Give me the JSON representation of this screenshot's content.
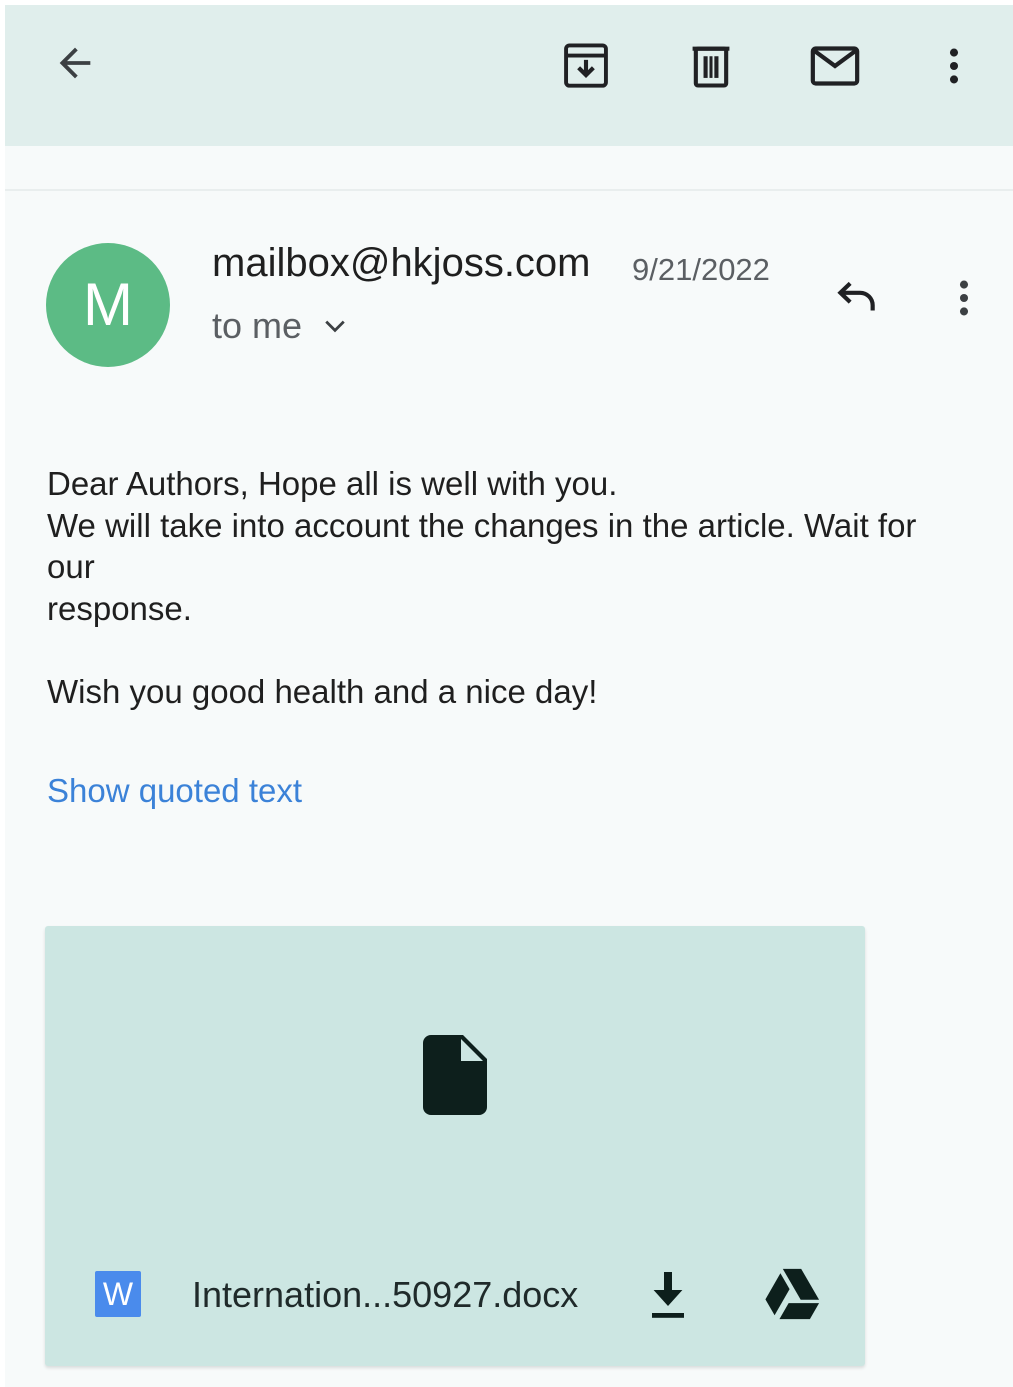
{
  "toolbar": {
    "back_icon": "arrow-left-icon",
    "actions": [
      "archive-icon",
      "trash-icon",
      "mark-unread-icon",
      "more-vert-icon"
    ]
  },
  "message": {
    "avatar_letter": "M",
    "sender": "mailbox@hkjoss.com",
    "date": "9/21/2022",
    "recipient_label": "to me",
    "body": {
      "line1": "Dear Authors, Hope all is well with you.",
      "line2": "We will take into account the changes in the article. Wait for our",
      "line3": "response.",
      "line4": "Wish you good health and a nice day!"
    },
    "show_quoted_label": "Show quoted text"
  },
  "attachment": {
    "badge_letter": "W",
    "filename": "Internation...50927.docx"
  },
  "colors": {
    "appbar": "#e0eeec",
    "background": "#f7fafa",
    "avatar": "#5cbb85",
    "link": "#3b82d8",
    "attachment_card": "#cce6e2",
    "word_badge": "#4a8bec"
  }
}
